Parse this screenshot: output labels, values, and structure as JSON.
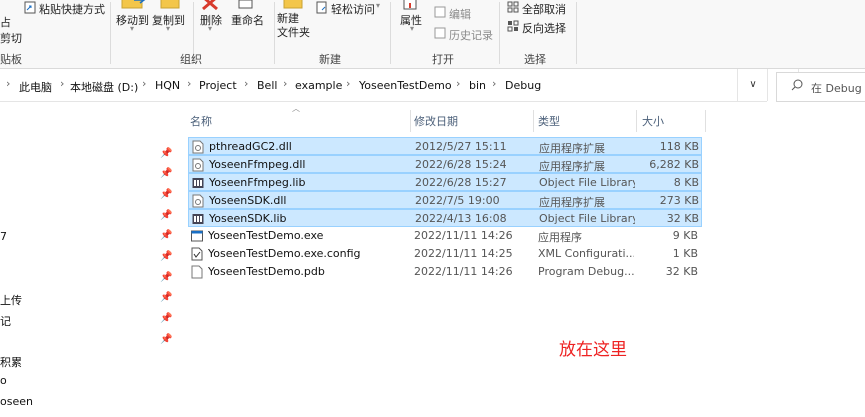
{
  "ribbon": {
    "clipboard": {
      "paste_shortcut_label": "粘贴快捷方式",
      "partial_1": "占",
      "partial_2": "剪切",
      "group_label_partial": "贴板"
    },
    "organize": {
      "move_to": "移动到",
      "copy_to": "复制到",
      "delete": "删除",
      "rename": "重命名",
      "group_label": "组织"
    },
    "new": {
      "new_folder": "新建\n文件夹",
      "easy_access": "轻松访问",
      "group_label": "新建"
    },
    "open": {
      "properties": "属性",
      "edit": "编辑",
      "history": "历史记录",
      "group_label": "打开"
    },
    "select": {
      "select_all": "全部取消",
      "invert": "反向选择",
      "group_label": "选择"
    }
  },
  "address": {
    "crumbs": [
      "此电脑",
      "本地磁盘 (D:)",
      "HQN",
      "Project",
      "Bell",
      "example",
      "YoseenTestDemo",
      "bin",
      "Debug"
    ],
    "search_placeholder": "在 Debug 中"
  },
  "nav": {
    "items": [
      "7",
      "上传",
      "记",
      "积累",
      "o",
      "oseen"
    ]
  },
  "columns": {
    "name": "名称",
    "date": "修改日期",
    "type": "类型",
    "size": "大小"
  },
  "files": [
    {
      "name": "pthreadGC2.dll",
      "date": "2012/5/27 15:11",
      "type": "应用程序扩展",
      "size": "118 KB",
      "icon": "dll-icon",
      "selected": true
    },
    {
      "name": "YoseenFfmpeg.dll",
      "date": "2022/6/28 15:24",
      "type": "应用程序扩展",
      "size": "6,282 KB",
      "icon": "dll-icon",
      "selected": true
    },
    {
      "name": "YoseenFfmpeg.lib",
      "date": "2022/6/28 15:27",
      "type": "Object File Library",
      "size": "8 KB",
      "icon": "lib-icon",
      "selected": true
    },
    {
      "name": "YoseenSDK.dll",
      "date": "2022/7/5 19:00",
      "type": "应用程序扩展",
      "size": "273 KB",
      "icon": "dll-icon",
      "selected": true
    },
    {
      "name": "YoseenSDK.lib",
      "date": "2022/4/13 16:08",
      "type": "Object File Library",
      "size": "32 KB",
      "icon": "lib-icon",
      "selected": true
    },
    {
      "name": "YoseenTestDemo.exe",
      "date": "2022/11/11 14:26",
      "type": "应用程序",
      "size": "9 KB",
      "icon": "exe-icon",
      "selected": false
    },
    {
      "name": "YoseenTestDemo.exe.config",
      "date": "2022/11/11 14:25",
      "type": "XML Configurati...",
      "size": "1 KB",
      "icon": "config-icon",
      "selected": false
    },
    {
      "name": "YoseenTestDemo.pdb",
      "date": "2022/11/11 14:26",
      "type": "Program Debug...",
      "size": "32 KB",
      "icon": "pdb-icon",
      "selected": false
    }
  ],
  "annotation": "放在这里",
  "colors": {
    "selection": "#cce8ff",
    "selection_border": "#99d1ff",
    "annotation": "#ee2222"
  }
}
